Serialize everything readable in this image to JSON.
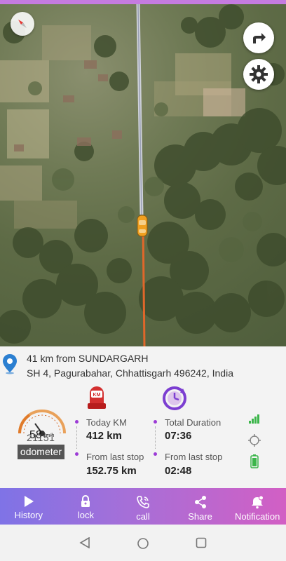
{
  "location": {
    "distance": "41 km from SUNDARGARH",
    "address": "SH 4, Pagurabahar, Chhattisgarh 496242, India"
  },
  "speedometer": {
    "speed": "58",
    "unit": "Km/h",
    "odometer_value": "21151",
    "odometer_label": "odometer"
  },
  "stats": {
    "today_km_label": "Today KM",
    "today_km_value": "412 km",
    "from_last_stop_km_label": "From last stop",
    "from_last_stop_km_value": "152.75 km",
    "total_duration_label": "Total Duration",
    "total_duration_value": "07:36",
    "from_last_stop_time_label": "From last stop",
    "from_last_stop_time_value": "02:48",
    "km_badge": "KM"
  },
  "nav": [
    {
      "label": "History",
      "icon": "play-icon"
    },
    {
      "label": "lock",
      "icon": "lock-icon"
    },
    {
      "label": "call",
      "icon": "phone-icon"
    },
    {
      "label": "Share",
      "icon": "share-icon"
    },
    {
      "label": "Notification",
      "icon": "bell-icon"
    }
  ],
  "colors": {
    "accent_purple": "#9c3bd6",
    "route_orange": "#e0672a",
    "nav_start": "#7f73e6",
    "nav_end": "#d25fc4"
  }
}
